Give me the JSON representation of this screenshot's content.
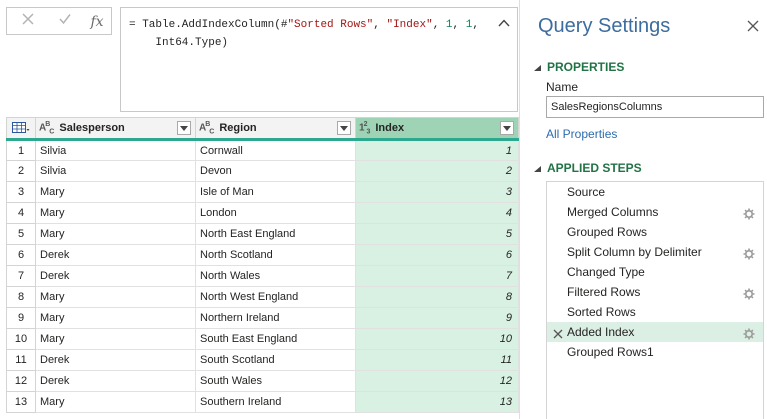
{
  "formula": {
    "cancel_icon": "cancel-icon",
    "commit_icon": "check-icon",
    "fx_label": "fx",
    "code": {
      "p1": "= Table.AddIndexColumn(#",
      "s1": "\"Sorted Rows\"",
      "p2": ", ",
      "s2": "\"Index\"",
      "p3": ", ",
      "n1": "1",
      "p4": ", ",
      "n2": "1",
      "p5": ",\n    Int64.Type)"
    }
  },
  "grid": {
    "columns": [
      {
        "type_icon": "ABC",
        "label": "Salesperson"
      },
      {
        "type_icon": "ABC",
        "label": "Region"
      },
      {
        "type_icon": "123",
        "label": "Index"
      }
    ],
    "rows": [
      {
        "n": "1",
        "salesperson": "Silvia",
        "region": "Cornwall",
        "index": "1"
      },
      {
        "n": "2",
        "salesperson": "Silvia",
        "region": "Devon",
        "index": "2"
      },
      {
        "n": "3",
        "salesperson": "Mary",
        "region": "Isle of Man",
        "index": "3"
      },
      {
        "n": "4",
        "salesperson": "Mary",
        "region": "London",
        "index": "4"
      },
      {
        "n": "5",
        "salesperson": "Mary",
        "region": "North East England",
        "index": "5"
      },
      {
        "n": "6",
        "salesperson": "Derek",
        "region": "North Scotland",
        "index": "6"
      },
      {
        "n": "7",
        "salesperson": "Derek",
        "region": "North Wales",
        "index": "7"
      },
      {
        "n": "8",
        "salesperson": "Mary",
        "region": "North West England",
        "index": "8"
      },
      {
        "n": "9",
        "salesperson": "Mary",
        "region": "Northern Ireland",
        "index": "9"
      },
      {
        "n": "10",
        "salesperson": "Mary",
        "region": "South East England",
        "index": "10"
      },
      {
        "n": "11",
        "salesperson": "Derek",
        "region": "South Scotland",
        "index": "11"
      },
      {
        "n": "12",
        "salesperson": "Derek",
        "region": "South Wales",
        "index": "12"
      },
      {
        "n": "13",
        "salesperson": "Mary",
        "region": "Southern Ireland",
        "index": "13"
      }
    ]
  },
  "settings": {
    "title": "Query Settings",
    "properties_header": "PROPERTIES",
    "name_label": "Name",
    "name_value": "SalesRegionsColumns",
    "all_properties_link": "All Properties",
    "applied_steps_header": "APPLIED STEPS",
    "steps": [
      {
        "label": "Source",
        "gear": false
      },
      {
        "label": "Merged Columns",
        "gear": true
      },
      {
        "label": "Grouped Rows",
        "gear": false
      },
      {
        "label": "Split Column by Delimiter",
        "gear": true
      },
      {
        "label": "Changed Type",
        "gear": false
      },
      {
        "label": "Filtered Rows",
        "gear": true
      },
      {
        "label": "Sorted Rows",
        "gear": false
      },
      {
        "label": "Added Index",
        "gear": true,
        "active": true
      },
      {
        "label": "Grouped Rows1",
        "gear": false
      }
    ]
  },
  "colors": {
    "accent_green": "#217346",
    "index_header": "#9ed4b5",
    "index_cell": "#d9f1e3",
    "title_blue": "#3c6d9e",
    "link_blue": "#2b6cb0"
  }
}
